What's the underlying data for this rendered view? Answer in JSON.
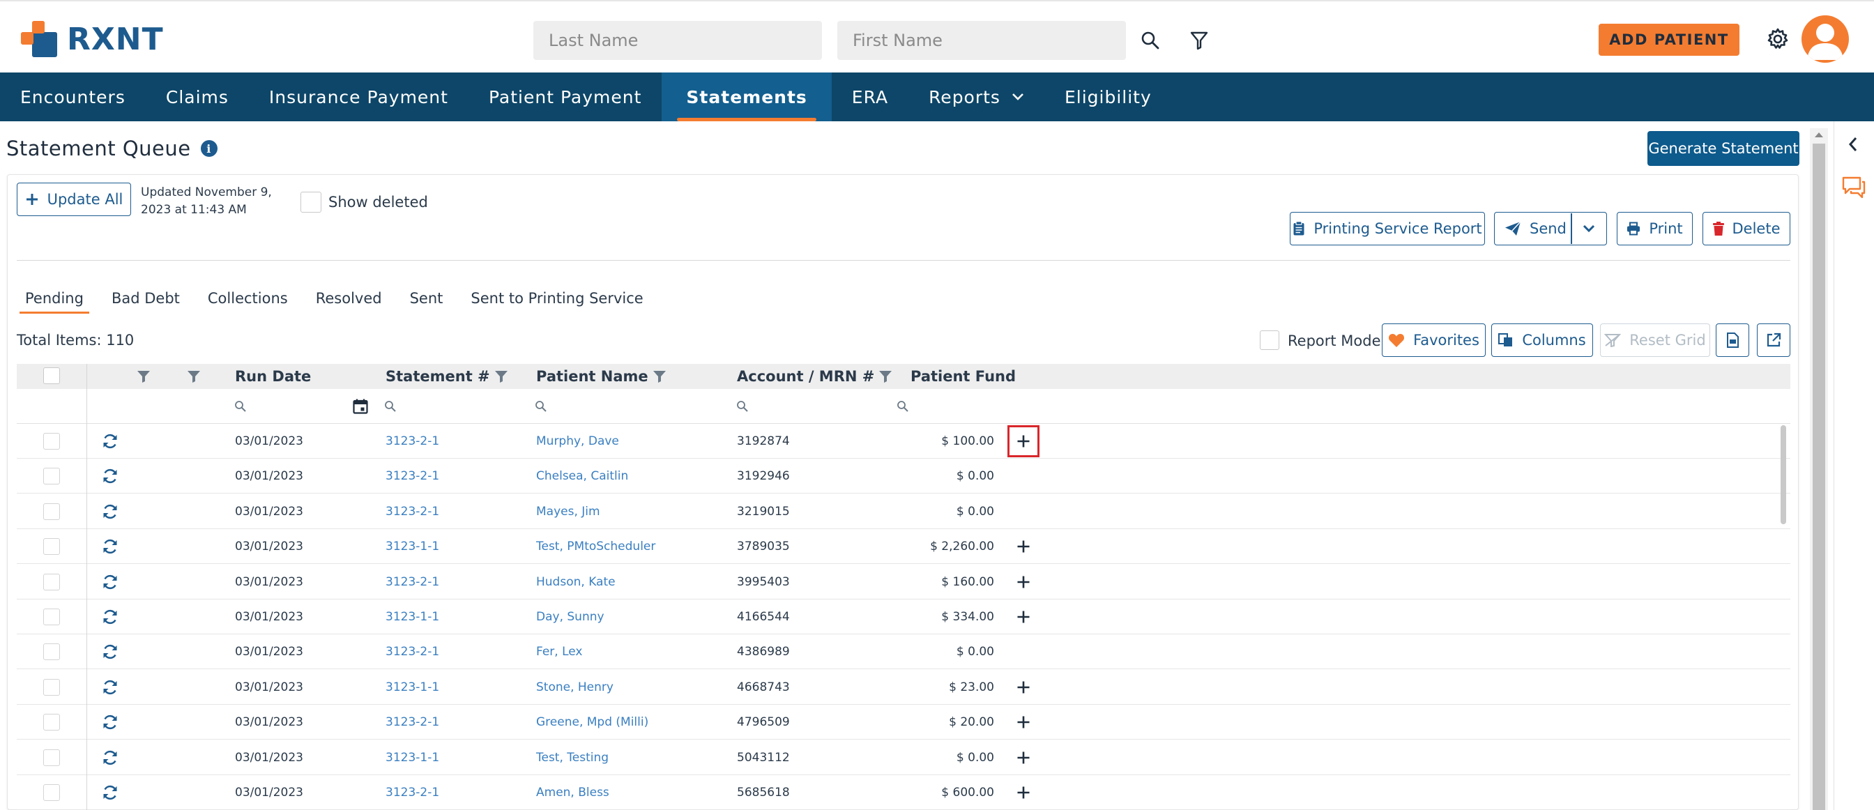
{
  "brand": {
    "name": "RXNT"
  },
  "header": {
    "last_name_placeholder": "Last Name",
    "first_name_placeholder": "First Name",
    "add_patient_label": "ADD PATIENT"
  },
  "nav": {
    "items": [
      {
        "label": "Encounters"
      },
      {
        "label": "Claims"
      },
      {
        "label": "Insurance Payment"
      },
      {
        "label": "Patient Payment"
      },
      {
        "label": "Statements"
      },
      {
        "label": "ERA"
      },
      {
        "label": "Reports"
      },
      {
        "label": "Eligibility"
      }
    ],
    "active": "Statements"
  },
  "page": {
    "title": "Statement Queue",
    "generate_label": "Generate Statement",
    "update_all_label": "Update All",
    "updated_line1": "Updated November 9,",
    "updated_line2": "2023 at 11:43 AM",
    "show_deleted_label": "Show deleted",
    "printing_service_label": "Printing Service Report",
    "send_label": "Send",
    "print_label": "Print",
    "delete_label": "Delete"
  },
  "tabs": [
    {
      "label": "Pending"
    },
    {
      "label": "Bad Debt"
    },
    {
      "label": "Collections"
    },
    {
      "label": "Resolved"
    },
    {
      "label": "Sent"
    },
    {
      "label": "Sent to Printing Service"
    }
  ],
  "active_tab": "Pending",
  "toolbar": {
    "total_items": "Total Items: 110",
    "report_mode_label": "Report Mode",
    "favorites_label": "Favorites",
    "columns_label": "Columns",
    "reset_grid_label": "Reset Grid"
  },
  "grid": {
    "columns": {
      "run_date": "Run Date",
      "statement": "Statement #",
      "patient_name": "Patient Name",
      "account": "Account / MRN #",
      "patient_fund": "Patient Fund"
    },
    "rows": [
      {
        "run_date": "03/01/2023",
        "statement": "3123-2-1",
        "patient": "Murphy, Dave",
        "account": "3192874",
        "fund": "$ 100.00",
        "plus": true
      },
      {
        "run_date": "03/01/2023",
        "statement": "3123-2-1",
        "patient": "Chelsea, Caitlin",
        "account": "3192946",
        "fund": "$ 0.00",
        "plus": false
      },
      {
        "run_date": "03/01/2023",
        "statement": "3123-2-1",
        "patient": "Mayes, Jim",
        "account": "3219015",
        "fund": "$ 0.00",
        "plus": false
      },
      {
        "run_date": "03/01/2023",
        "statement": "3123-1-1",
        "patient": "Test, PMtoScheduler",
        "account": "3789035",
        "fund": "$ 2,260.00",
        "plus": true
      },
      {
        "run_date": "03/01/2023",
        "statement": "3123-2-1",
        "patient": "Hudson, Kate",
        "account": "3995403",
        "fund": "$ 160.00",
        "plus": true
      },
      {
        "run_date": "03/01/2023",
        "statement": "3123-1-1",
        "patient": "Day, Sunny",
        "account": "4166544",
        "fund": "$ 334.00",
        "plus": true
      },
      {
        "run_date": "03/01/2023",
        "statement": "3123-2-1",
        "patient": "Fer, Lex",
        "account": "4386989",
        "fund": "$ 0.00",
        "plus": false
      },
      {
        "run_date": "03/01/2023",
        "statement": "3123-1-1",
        "patient": "Stone, Henry",
        "account": "4668743",
        "fund": "$ 23.00",
        "plus": true
      },
      {
        "run_date": "03/01/2023",
        "statement": "3123-2-1",
        "patient": "Greene, Mpd (Milli)",
        "account": "4796509",
        "fund": "$ 20.00",
        "plus": true
      },
      {
        "run_date": "03/01/2023",
        "statement": "3123-1-1",
        "patient": "Test, Testing",
        "account": "5043112",
        "fund": "$ 0.00",
        "plus": true
      },
      {
        "run_date": "03/01/2023",
        "statement": "3123-2-1",
        "patient": "Amen, Bless",
        "account": "5685618",
        "fund": "$ 600.00",
        "plus": true
      }
    ]
  },
  "colors": {
    "brand_blue": "#1d5b8f",
    "nav_bg": "#0d4668",
    "accent_orange": "#f47c30",
    "link_blue": "#3a7fc1"
  }
}
